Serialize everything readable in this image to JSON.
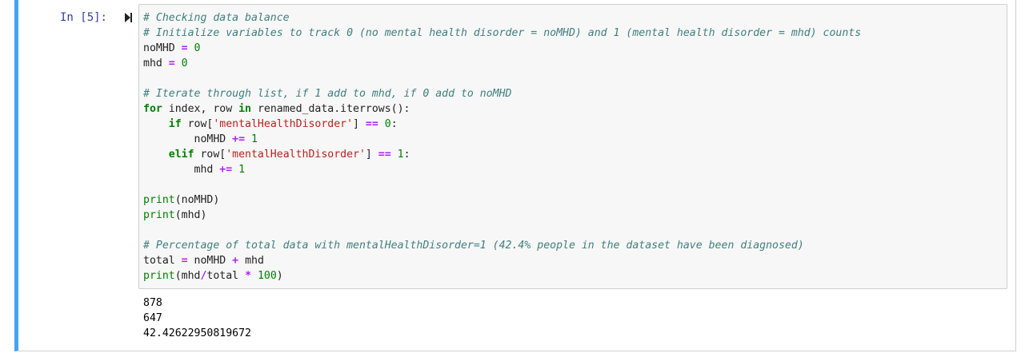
{
  "cell": {
    "prompt": "In [5]:"
  },
  "code": {
    "lines": [
      {
        "tokens": [
          {
            "t": "cm",
            "v": "# Checking data balance"
          }
        ]
      },
      {
        "tokens": [
          {
            "t": "cm",
            "v": "# Initialize variables to track 0 (no mental health disorder = noMHD) and 1 (mental health disorder = mhd) counts"
          }
        ]
      },
      {
        "tokens": [
          {
            "t": "",
            "v": "noMHD "
          },
          {
            "t": "op",
            "v": "="
          },
          {
            "t": "",
            "v": " "
          },
          {
            "t": "num",
            "v": "0"
          }
        ]
      },
      {
        "tokens": [
          {
            "t": "",
            "v": "mhd "
          },
          {
            "t": "op",
            "v": "="
          },
          {
            "t": "",
            "v": " "
          },
          {
            "t": "num",
            "v": "0"
          }
        ]
      },
      {
        "tokens": []
      },
      {
        "tokens": [
          {
            "t": "cm",
            "v": "# Iterate through list, if 1 add to mhd, if 0 add to noMHD"
          }
        ]
      },
      {
        "tokens": [
          {
            "t": "kw",
            "v": "for"
          },
          {
            "t": "",
            "v": " index, row "
          },
          {
            "t": "kw",
            "v": "in"
          },
          {
            "t": "",
            "v": " renamed_data.iterrows():"
          }
        ]
      },
      {
        "tokens": [
          {
            "t": "",
            "v": "    "
          },
          {
            "t": "kw",
            "v": "if"
          },
          {
            "t": "",
            "v": " row["
          },
          {
            "t": "str",
            "v": "'mentalHealthDisorder'"
          },
          {
            "t": "",
            "v": "] "
          },
          {
            "t": "op",
            "v": "=="
          },
          {
            "t": "",
            "v": " "
          },
          {
            "t": "num",
            "v": "0"
          },
          {
            "t": "",
            "v": ":"
          }
        ]
      },
      {
        "tokens": [
          {
            "t": "",
            "v": "        noMHD "
          },
          {
            "t": "op",
            "v": "+="
          },
          {
            "t": "",
            "v": " "
          },
          {
            "t": "num",
            "v": "1"
          }
        ]
      },
      {
        "tokens": [
          {
            "t": "",
            "v": "    "
          },
          {
            "t": "kw",
            "v": "elif"
          },
          {
            "t": "",
            "v": " row["
          },
          {
            "t": "str",
            "v": "'mentalHealthDisorder'"
          },
          {
            "t": "",
            "v": "] "
          },
          {
            "t": "op",
            "v": "=="
          },
          {
            "t": "",
            "v": " "
          },
          {
            "t": "num",
            "v": "1"
          },
          {
            "t": "",
            "v": ":"
          }
        ]
      },
      {
        "tokens": [
          {
            "t": "",
            "v": "        mhd "
          },
          {
            "t": "op",
            "v": "+="
          },
          {
            "t": "",
            "v": " "
          },
          {
            "t": "num",
            "v": "1"
          }
        ]
      },
      {
        "tokens": []
      },
      {
        "tokens": [
          {
            "t": "bi",
            "v": "print"
          },
          {
            "t": "",
            "v": "(noMHD)"
          }
        ]
      },
      {
        "tokens": [
          {
            "t": "bi",
            "v": "print"
          },
          {
            "t": "",
            "v": "(mhd)"
          }
        ]
      },
      {
        "tokens": []
      },
      {
        "tokens": [
          {
            "t": "cm",
            "v": "# Percentage of total data with mentalHealthDisorder=1 (42.4% people in the dataset have been diagnosed)"
          }
        ]
      },
      {
        "tokens": [
          {
            "t": "",
            "v": "total "
          },
          {
            "t": "op",
            "v": "="
          },
          {
            "t": "",
            "v": " noMHD "
          },
          {
            "t": "op",
            "v": "+"
          },
          {
            "t": "",
            "v": " mhd"
          }
        ]
      },
      {
        "tokens": [
          {
            "t": "bi",
            "v": "print"
          },
          {
            "t": "",
            "v": "(mhd"
          },
          {
            "t": "op",
            "v": "/"
          },
          {
            "t": "",
            "v": "total "
          },
          {
            "t": "op",
            "v": "*"
          },
          {
            "t": "",
            "v": " "
          },
          {
            "t": "num",
            "v": "100"
          },
          {
            "t": "",
            "v": ")"
          }
        ]
      }
    ]
  },
  "output": {
    "lines": [
      "878",
      "647",
      "42.42622950819672"
    ]
  },
  "colors": {
    "cell_accent": "#42a5f5",
    "prompt": "#303f9f",
    "comment": "#408080",
    "keyword": "#008000",
    "operator": "#aa22ff",
    "string": "#ba2121",
    "number": "#008000"
  },
  "icons": {
    "run_marker": "run-cursor-icon"
  }
}
